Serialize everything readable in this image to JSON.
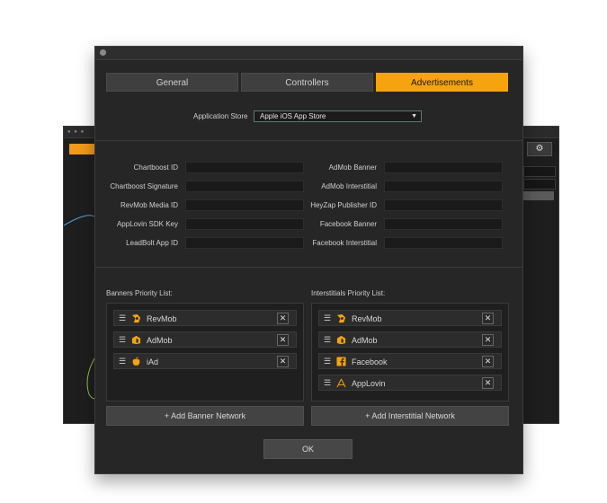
{
  "window": {
    "tabs": [
      {
        "label": "General",
        "active": false
      },
      {
        "label": "Controllers",
        "active": false
      },
      {
        "label": "Advertisements",
        "active": true
      }
    ]
  },
  "store": {
    "label": "Application Store",
    "selected": "Apple iOS App Store"
  },
  "fields_left": [
    {
      "label": "Chartboost ID",
      "value": ""
    },
    {
      "label": "Chartboost Signature",
      "value": ""
    },
    {
      "label": "RevMob Media ID",
      "value": ""
    },
    {
      "label": "AppLovin SDK Key",
      "value": ""
    },
    {
      "label": "LeadBolt App ID",
      "value": ""
    }
  ],
  "fields_right": [
    {
      "label": "AdMob Banner",
      "value": ""
    },
    {
      "label": "AdMob Interstitial",
      "value": ""
    },
    {
      "label": "HeyZap Publisher ID",
      "value": ""
    },
    {
      "label": "Facebook Banner",
      "value": ""
    },
    {
      "label": "Facebook Interstitial",
      "value": ""
    }
  ],
  "banners": {
    "title": "Banners Priority List:",
    "items": [
      {
        "name": "RevMob",
        "icon": "revmob-icon"
      },
      {
        "name": "AdMob",
        "icon": "admob-icon"
      },
      {
        "name": "iAd",
        "icon": "apple-icon"
      }
    ],
    "add_label": "+ Add Banner Network"
  },
  "interstitials": {
    "title": "Interstitials Priority List:",
    "items": [
      {
        "name": "RevMob",
        "icon": "revmob-icon"
      },
      {
        "name": "AdMob",
        "icon": "admob-icon"
      },
      {
        "name": "Facebook",
        "icon": "facebook-icon"
      },
      {
        "name": "AppLovin",
        "icon": "applovin-icon"
      }
    ],
    "add_label": "+ Add Interstitial Network"
  },
  "ok_label": "OK",
  "colors": {
    "accent": "#f5a30f",
    "window_bg": "#262626",
    "item_bg": "#2c2c2c"
  }
}
